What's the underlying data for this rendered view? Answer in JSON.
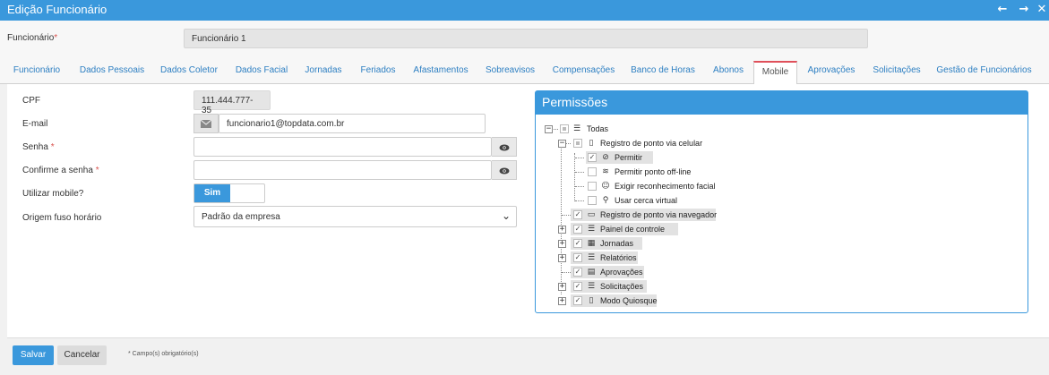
{
  "window": {
    "title": "Edição Funcionário"
  },
  "funcionario": {
    "label": "Funcionário",
    "required_mark": "*",
    "value": "Funcionário 1"
  },
  "tabs": [
    {
      "label": "Funcionário"
    },
    {
      "label": "Dados Pessoais"
    },
    {
      "label": "Dados Coletor"
    },
    {
      "label": "Dados Facial"
    },
    {
      "label": "Jornadas"
    },
    {
      "label": "Feriados"
    },
    {
      "label": "Afastamentos"
    },
    {
      "label": "Sobreavisos"
    },
    {
      "label": "Compensações"
    },
    {
      "label": "Banco de Horas"
    },
    {
      "label": "Abonos"
    },
    {
      "label": "Mobile",
      "active": true
    },
    {
      "label": "Aprovações"
    },
    {
      "label": "Solicitações"
    },
    {
      "label": "Gestão de Funcionários"
    }
  ],
  "form": {
    "cpf": {
      "label": "CPF",
      "value": "111.444.777-35"
    },
    "email": {
      "label": "E-mail",
      "value": "funcionario1@topdata.com.br"
    },
    "senha": {
      "label": "Senha",
      "required_mark": "*",
      "value": ""
    },
    "confirme": {
      "label": "Confirme a senha",
      "required_mark": "*",
      "value": ""
    },
    "mobile": {
      "label": "Utilizar mobile?",
      "toggle_on_label": "Sim"
    },
    "fuso": {
      "label": "Origem fuso horário",
      "selected": "Padrão da empresa"
    }
  },
  "permissions": {
    "title": "Permissões",
    "tree": {
      "root": "Todas",
      "celular": "Registro de ponto via celular",
      "permitir": "Permitir",
      "offline": "Permitir ponto off-line",
      "facial": "Exigir reconhecimento facial",
      "cerca": "Usar cerca virtual",
      "navegador": "Registro de ponto via navegador",
      "painel": "Painel de controle",
      "jornadas": "Jornadas",
      "relatorios": "Relatórios",
      "aprovacoes": "Aprovações",
      "solicitacoes": "Solicitações",
      "quiosque": "Modo Quiosque"
    }
  },
  "footer": {
    "save_label": "Salvar",
    "cancel_label": "Cancelar",
    "required_note": "* Campo(s) obrigatório(s)"
  },
  "icons": {
    "prev": "arrow-left-icon",
    "next": "arrow-right-icon",
    "envelope": "envelope-icon",
    "eye": "eye-icon",
    "chevron": "chevron-down-icon",
    "list": "list-icon",
    "mobile": "mobile-icon",
    "check-circle": "check-circle-icon",
    "wifi": "wifi-icon",
    "smile": "smile-icon",
    "map-marker": "map-marker-icon",
    "monitor": "monitor-icon",
    "calendar": "calendar-icon",
    "file": "file-icon",
    "tablet": "tablet-icon"
  },
  "colors": {
    "primary": "#3a98dc",
    "active_tab_accent": "#e0505a",
    "required": "#d9534f"
  }
}
